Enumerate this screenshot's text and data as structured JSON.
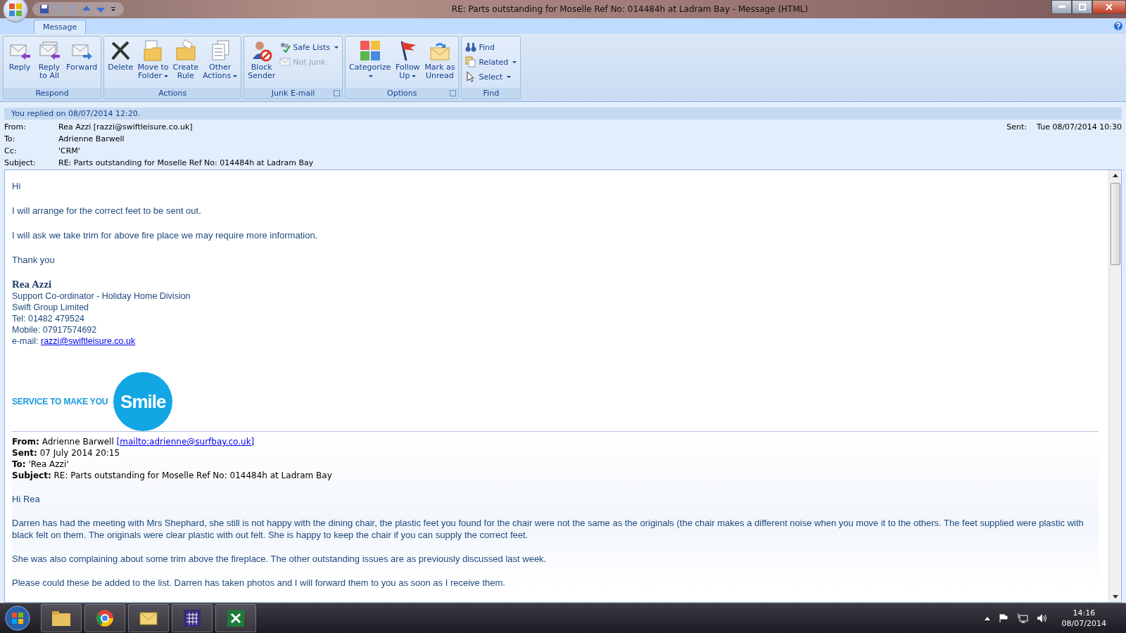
{
  "window": {
    "title": "RE: Parts outstanding for Moselle Ref No:  014484h at Ladram Bay  -  Message (HTML)"
  },
  "tabs": [
    {
      "label": "Message",
      "selected": true
    }
  ],
  "ribbon": {
    "groups": [
      {
        "label": "Respond",
        "launcher": false,
        "buttons": [
          {
            "lines": [
              "Reply"
            ],
            "kind": "large",
            "dropdown": false,
            "disabled": false
          },
          {
            "lines": [
              "Reply",
              "to All"
            ],
            "kind": "large",
            "dropdown": false,
            "disabled": false
          },
          {
            "lines": [
              "Forward"
            ],
            "kind": "large",
            "dropdown": false,
            "disabled": false
          }
        ]
      },
      {
        "label": "Actions",
        "launcher": false,
        "buttons": [
          {
            "lines": [
              "Delete"
            ],
            "kind": "large",
            "dropdown": false,
            "disabled": false
          },
          {
            "lines": [
              "Move to",
              "Folder"
            ],
            "kind": "large",
            "dropdown": true,
            "disabled": false
          },
          {
            "lines": [
              "Create",
              "Rule"
            ],
            "kind": "large",
            "dropdown": false,
            "disabled": false
          },
          {
            "lines": [
              "Other",
              "Actions"
            ],
            "kind": "large",
            "dropdown": true,
            "disabled": false
          }
        ]
      },
      {
        "label": "Junk E-mail",
        "launcher": true,
        "buttons": [
          {
            "lines": [
              "Block",
              "Sender"
            ],
            "kind": "large",
            "dropdown": false,
            "disabled": false
          },
          {
            "lines": [
              "Safe Lists"
            ],
            "kind": "small",
            "dropdown": true,
            "disabled": false
          },
          {
            "lines": [
              "Not Junk"
            ],
            "kind": "small",
            "dropdown": false,
            "disabled": true
          }
        ]
      },
      {
        "label": "Options",
        "launcher": true,
        "buttons": [
          {
            "lines": [
              "Categorize"
            ],
            "kind": "large",
            "dropdown": true,
            "disabled": false
          },
          {
            "lines": [
              "Follow",
              "Up"
            ],
            "kind": "large",
            "dropdown": true,
            "disabled": false
          },
          {
            "lines": [
              "Mark as",
              "Unread"
            ],
            "kind": "large",
            "dropdown": false,
            "disabled": false
          }
        ]
      },
      {
        "label": "Find",
        "launcher": false,
        "buttons": [
          {
            "lines": [
              "Find"
            ],
            "kind": "small",
            "dropdown": false,
            "disabled": false
          },
          {
            "lines": [
              "Related"
            ],
            "kind": "small",
            "dropdown": true,
            "disabled": false
          },
          {
            "lines": [
              "Select"
            ],
            "kind": "small",
            "dropdown": true,
            "disabled": false
          }
        ]
      }
    ]
  },
  "info_bar": "You replied on 08/07/2014 12:20.",
  "header": {
    "fields": [
      {
        "label": "From:",
        "value": "Rea Azzi [razzi@swiftleisure.co.uk]"
      },
      {
        "label": "To:",
        "value": "Adrienne Barwell"
      },
      {
        "label": "Cc:",
        "value": "'CRM'"
      },
      {
        "label": "Subject:",
        "value": "RE: Parts outstanding for Moselle Ref No:  014484h at Ladram Bay"
      }
    ],
    "sent": {
      "label": "Sent:",
      "value": "Tue 08/07/2014 10:30"
    }
  },
  "body": {
    "paragraphs": [
      "Hi",
      "I will arrange for the correct feet to be sent out.",
      "I will ask we take trim for above fire place we may require more information.",
      "Thank you"
    ],
    "signature": {
      "name": "Rea Azzi",
      "lines": [
        "Support Co-ordinator - Holiday Home Division",
        "Swift Group Limited",
        "Tel: 01482 479524",
        "Mobile: 07917574692"
      ],
      "email_label": "e-mail: ",
      "email": "razzi@swiftleisure.co.uk"
    },
    "logo": {
      "tagline": "SERVICE TO MAKE YOU",
      "word": "Smile"
    }
  },
  "quoted": {
    "fields": [
      {
        "label": "From:",
        "value": "Adrienne Barwell ",
        "link": "[mailto:adrienne@surfbay.co.uk]"
      },
      {
        "label": "Sent:",
        "value": "07 July 2014 20:15"
      },
      {
        "label": "To:",
        "value": "'Rea Azzi'"
      },
      {
        "label": "Subject:",
        "value": "RE: Parts outstanding for Moselle Ref No: 014484h at Ladram Bay"
      }
    ],
    "paragraphs": [
      "Hi Rea",
      "Darren has had the meeting with Mrs  Shephard, she still is not happy with the dining chair, the plastic feet you found for the chair were not the same as the originals (the chair makes a different noise when you move it to the others.  The feet supplied were plastic with black felt on them. The originals were clear plastic with out felt. She is happy to keep the chair if you can supply the correct feet.",
      "She was also complaining about some trim above the fireplace.  The other outstanding issues  are as previously discussed last week.",
      "Please could these be added to the list.  Darren has taken photos and I will forward them to you as soon as I receive them."
    ]
  },
  "taskbar": {
    "time": "14:16",
    "date": "08/07/2014"
  }
}
